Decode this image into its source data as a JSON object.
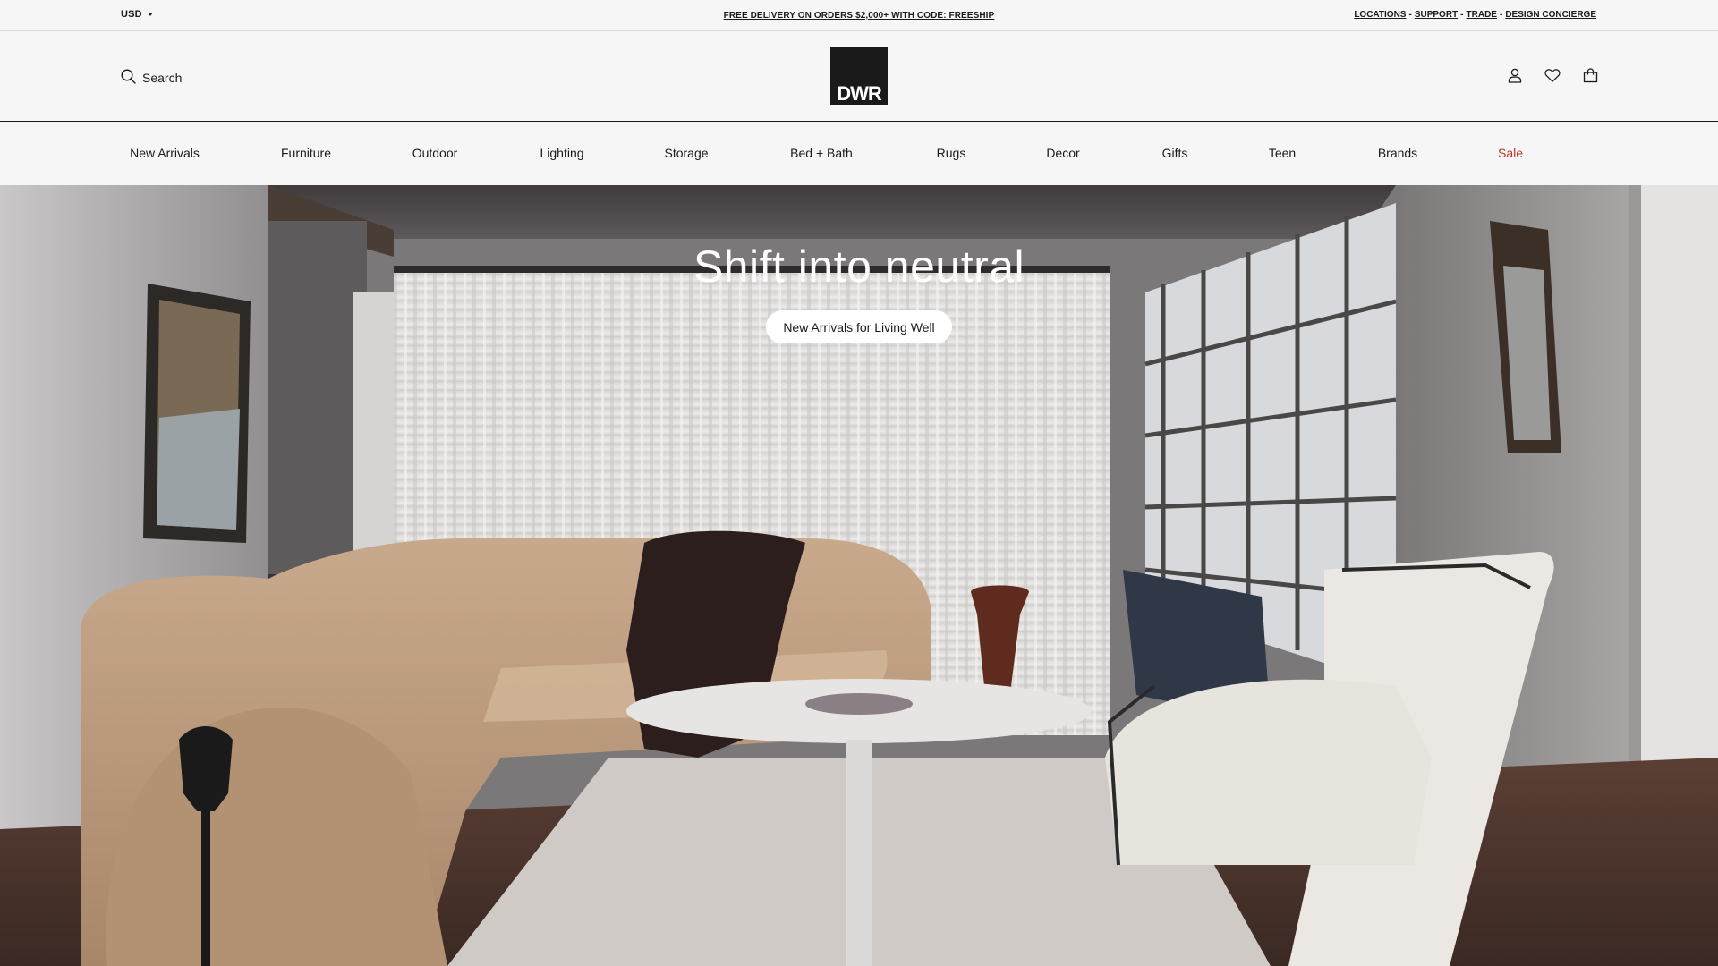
{
  "utility": {
    "currency": "USD",
    "promo": "FREE DELIVERY ON ORDERS $2,000+ WITH CODE: FREESHIP",
    "links": [
      "LOCATIONS",
      "SUPPORT",
      "TRADE",
      "DESIGN CONCIERGE"
    ],
    "separator": "-"
  },
  "header": {
    "search_label": "Search",
    "logo_text": "DWR",
    "icons": [
      "account-icon",
      "wishlist-heart-icon",
      "shopping-bag-icon"
    ]
  },
  "nav": {
    "items": [
      "New Arrivals",
      "Furniture",
      "Outdoor",
      "Lighting",
      "Storage",
      "Bed + Bath",
      "Rugs",
      "Decor",
      "Gifts",
      "Teen",
      "Brands",
      "Sale"
    ],
    "sale_color": "#c0392b"
  },
  "hero": {
    "title": "Shift into neutral",
    "cta": "New Arrivals for Living Well"
  }
}
